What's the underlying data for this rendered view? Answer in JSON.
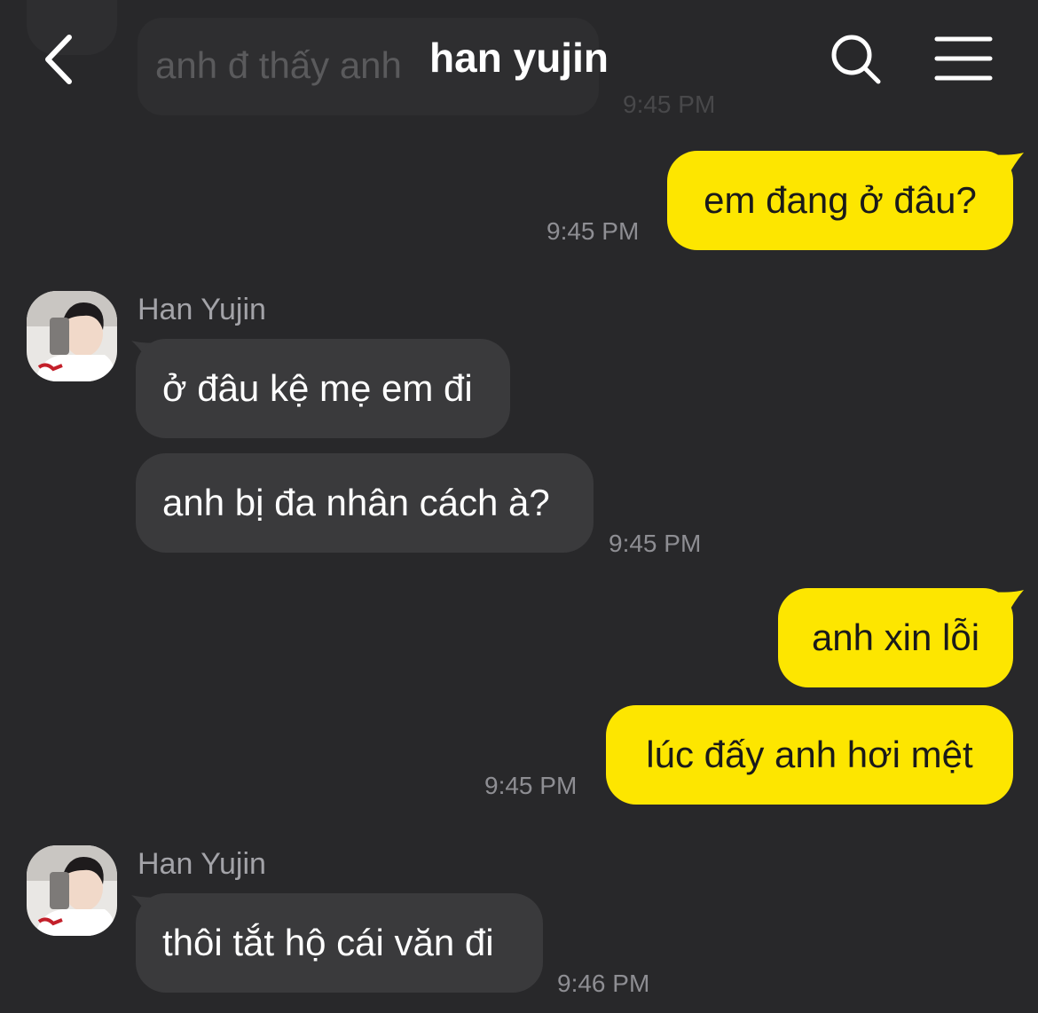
{
  "header": {
    "title": "han yujin"
  },
  "ghost_message": {
    "text": "anh đ thấy anh",
    "time": "9:45 PM"
  },
  "messages": [
    {
      "sender": "me",
      "text": "em đang ở đâu?",
      "time": "9:45 PM"
    },
    {
      "sender": "Han Yujin",
      "texts": [
        "ở đâu kệ mẹ em đi",
        "anh bị đa nhân cách à?"
      ],
      "time": "9:45 PM"
    },
    {
      "sender": "me",
      "texts": [
        "anh xin lỗi",
        "lúc đấy anh hơi mệt"
      ],
      "time": "9:45 PM"
    },
    {
      "sender": "Han Yujin",
      "texts": [
        "thôi tắt hộ cái văn đi"
      ],
      "time": "9:46 PM"
    }
  ],
  "colors": {
    "background": "#28282a",
    "incoming_bubble": "#3a3a3c",
    "outgoing_bubble": "#fde600"
  },
  "icons": {
    "back": "chevron-left-icon",
    "search": "search-icon",
    "menu": "hamburger-menu-icon"
  }
}
